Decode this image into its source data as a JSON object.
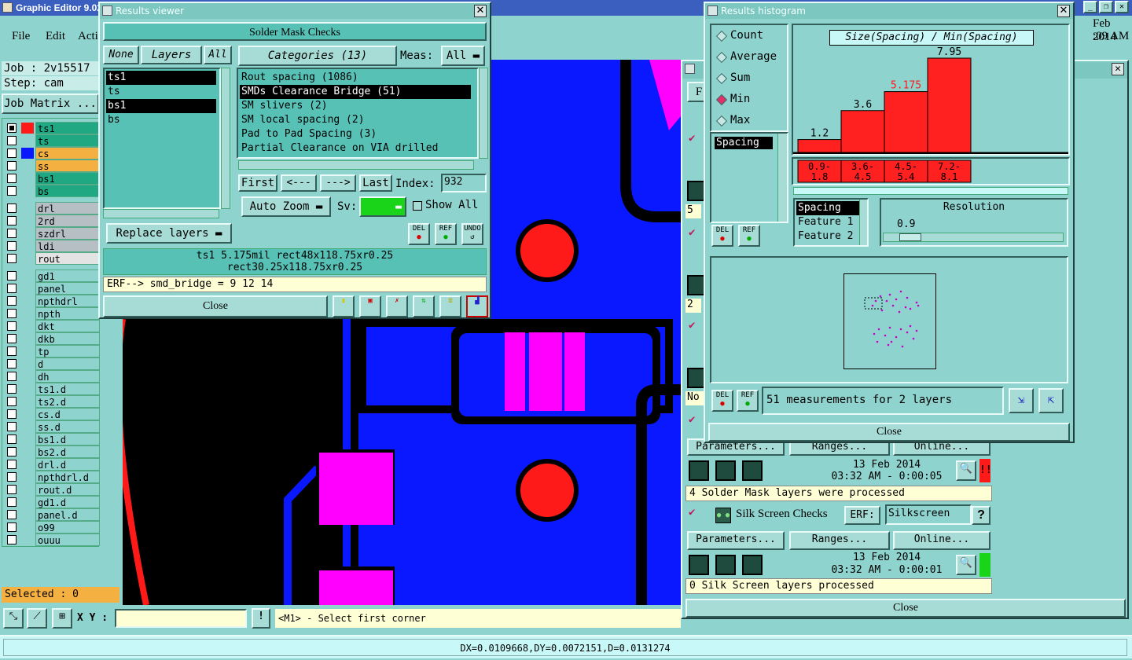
{
  "main_window": {
    "title": "Graphic Editor 9.02",
    "menu": [
      "File",
      "Edit",
      "Acti"
    ],
    "datetime": [
      "Feb 2014",
      ":09 AM"
    ],
    "job_label": "Job : 2v15517",
    "step_label": "Step: cam",
    "job_matrix_button": "Job Matrix ...",
    "selected_text": "Selected : 0",
    "xy_label": "X Y :",
    "xy_value": "",
    "prompt_text": "<M1> - Select first corner",
    "status_text": "DX=0.0109668,DY=0.0072151,D=0.0131274"
  },
  "layers": [
    {
      "name": "ts1",
      "color": "#ff1a1a",
      "active": true,
      "bg": "#1fa882"
    },
    {
      "name": "ts",
      "color": "",
      "bg": "#1fa882"
    },
    {
      "name": "cs",
      "color": "#0a18ff",
      "bg": "#f5b042"
    },
    {
      "name": "ss",
      "color": "",
      "bg": "#f5b042"
    },
    {
      "name": "bs1",
      "color": "",
      "bg": "#1fa882"
    },
    {
      "name": "bs",
      "color": "",
      "bg": "#1fa882"
    },
    {
      "name": "drl",
      "color": "",
      "bg": "#b6c0c4"
    },
    {
      "name": "2rd",
      "color": "",
      "bg": "#b6c0c4"
    },
    {
      "name": "szdrl",
      "color": "",
      "bg": "#b6c0c4"
    },
    {
      "name": "ldi",
      "color": "",
      "bg": "#b6c0c4"
    },
    {
      "name": "rout",
      "color": "",
      "bg": "#e3e3e3"
    },
    {
      "name": "gd1",
      "color": "",
      "bg": "#8fd3cf"
    },
    {
      "name": "panel",
      "color": "",
      "bg": "#8fd3cf"
    },
    {
      "name": "npthdrl",
      "color": "",
      "bg": "#8fd3cf"
    },
    {
      "name": "npth",
      "color": "",
      "bg": "#8fd3cf"
    },
    {
      "name": "dkt",
      "color": "",
      "bg": "#8fd3cf"
    },
    {
      "name": "dkb",
      "color": "",
      "bg": "#8fd3cf"
    },
    {
      "name": "tp",
      "color": "",
      "bg": "#8fd3cf"
    },
    {
      "name": "d",
      "color": "",
      "bg": "#8fd3cf"
    },
    {
      "name": "dh",
      "color": "",
      "bg": "#8fd3cf"
    },
    {
      "name": "ts1.d",
      "color": "",
      "bg": "#8fd3cf"
    },
    {
      "name": "ts2.d",
      "color": "",
      "bg": "#8fd3cf"
    },
    {
      "name": "cs.d",
      "color": "",
      "bg": "#8fd3cf"
    },
    {
      "name": "ss.d",
      "color": "",
      "bg": "#8fd3cf"
    },
    {
      "name": "bs1.d",
      "color": "",
      "bg": "#8fd3cf"
    },
    {
      "name": "bs2.d",
      "color": "",
      "bg": "#8fd3cf"
    },
    {
      "name": "drl.d",
      "color": "",
      "bg": "#8fd3cf"
    },
    {
      "name": "npthdrl.d",
      "color": "",
      "bg": "#8fd3cf"
    },
    {
      "name": "rout.d",
      "color": "",
      "bg": "#8fd3cf"
    },
    {
      "name": "gd1.d",
      "color": "",
      "bg": "#8fd3cf"
    },
    {
      "name": "panel.d",
      "color": "",
      "bg": "#8fd3cf"
    },
    {
      "name": "o99",
      "color": "",
      "bg": "#8fd3cf"
    },
    {
      "name": "ouuu",
      "color": "",
      "bg": "#8fd3cf"
    }
  ],
  "results_viewer": {
    "title": "Results viewer",
    "header": "Solder Mask Checks",
    "none_btn": "None",
    "layers_btn": "Layers",
    "all_btn": "All",
    "layer_list": [
      "ts1",
      "ts",
      "bs1",
      "bs"
    ],
    "categories_btn": "Categories (13)",
    "meas_label": "Meas:",
    "meas_value": "All",
    "categories": [
      "Rout spacing (1086)",
      "SMDs Clearance Bridge (51)",
      "SM slivers (2)",
      "SM local spacing (2)",
      "Pad to Pad Spacing (3)",
      "Partial Clearance on VIA drilled"
    ],
    "first_btn": "First",
    "prev_btn": "<---",
    "next_btn": "--->",
    "last_btn": "Last",
    "index_label": "Index:",
    "index_value": "932",
    "auto_zoom": "Auto Zoom",
    "sv_label": "Sv:",
    "show_all": "Show All",
    "replace_layers": "Replace layers",
    "info_line1": "ts1 5.175mil  rect48x118.75xr0.25",
    "info_line2": "rect30.25x118.75xr0.25",
    "erf_line": "ERF--> smd_bridge = 9 12 14",
    "close_btn": "Close",
    "del_label": "DEL",
    "ref_label": "REF",
    "undo_label": "UNDO"
  },
  "histogram": {
    "title": "Results histogram",
    "options": [
      "Count",
      "Average",
      "Sum",
      "Min",
      "Max"
    ],
    "selected_option": "Min",
    "chart_title": "Size(Spacing) / Min(Spacing)",
    "spacing_list": [
      "Spacing"
    ],
    "feature_list": [
      "Spacing",
      "Feature 1",
      "Feature 2"
    ],
    "resolution_label": "Resolution",
    "resolution_value": "0.9",
    "slider_fraction": 0.1,
    "measurements_text": "51 measurements for 2 layers",
    "close_btn": "Close",
    "del_label": "DEL",
    "ref_label": "REF"
  },
  "chart_data": {
    "type": "bar",
    "title": "Size(Spacing) / Min(Spacing)",
    "categories": [
      "0.9-\n1.8",
      "3.6-\n4.5",
      "4.5-\n5.4",
      "7.2-\n8.1"
    ],
    "category_lines": [
      [
        "0.9-",
        "1.8"
      ],
      [
        "3.6-",
        "4.5"
      ],
      [
        "4.5-",
        "5.4"
      ],
      [
        "7.2-",
        "8.1"
      ]
    ],
    "values": [
      1.2,
      3.6,
      5.175,
      7.95
    ],
    "value_labels": [
      "1.2",
      "3.6",
      "5.175",
      "7.95"
    ],
    "highlighted_index": 2,
    "bar_color": "#ff2020",
    "highlight_label_color": "#ff1a1a",
    "ylim": [
      0,
      7.95
    ]
  },
  "checklist": {
    "rows_numbers": [
      "5",
      "2",
      "No"
    ],
    "parameters_btn": "Parameters...",
    "ranges_btn": "Ranges...",
    "online_btn": "Online...",
    "date1": "13 Feb 2014",
    "time1": "03:32 AM - 0:00:05",
    "msg1": "4 Solder Mask layers were processed",
    "silk_label": "Silk Screen Checks",
    "erf_label": "ERF:",
    "erf_value": "Silkscreen",
    "help_btn": "?",
    "date2": "13 Feb 2014",
    "time2": "03:32 AM - 0:00:01",
    "msg2": "0 Silk Screen layers processed",
    "close_btn": "Close",
    "f_btn": "F"
  }
}
